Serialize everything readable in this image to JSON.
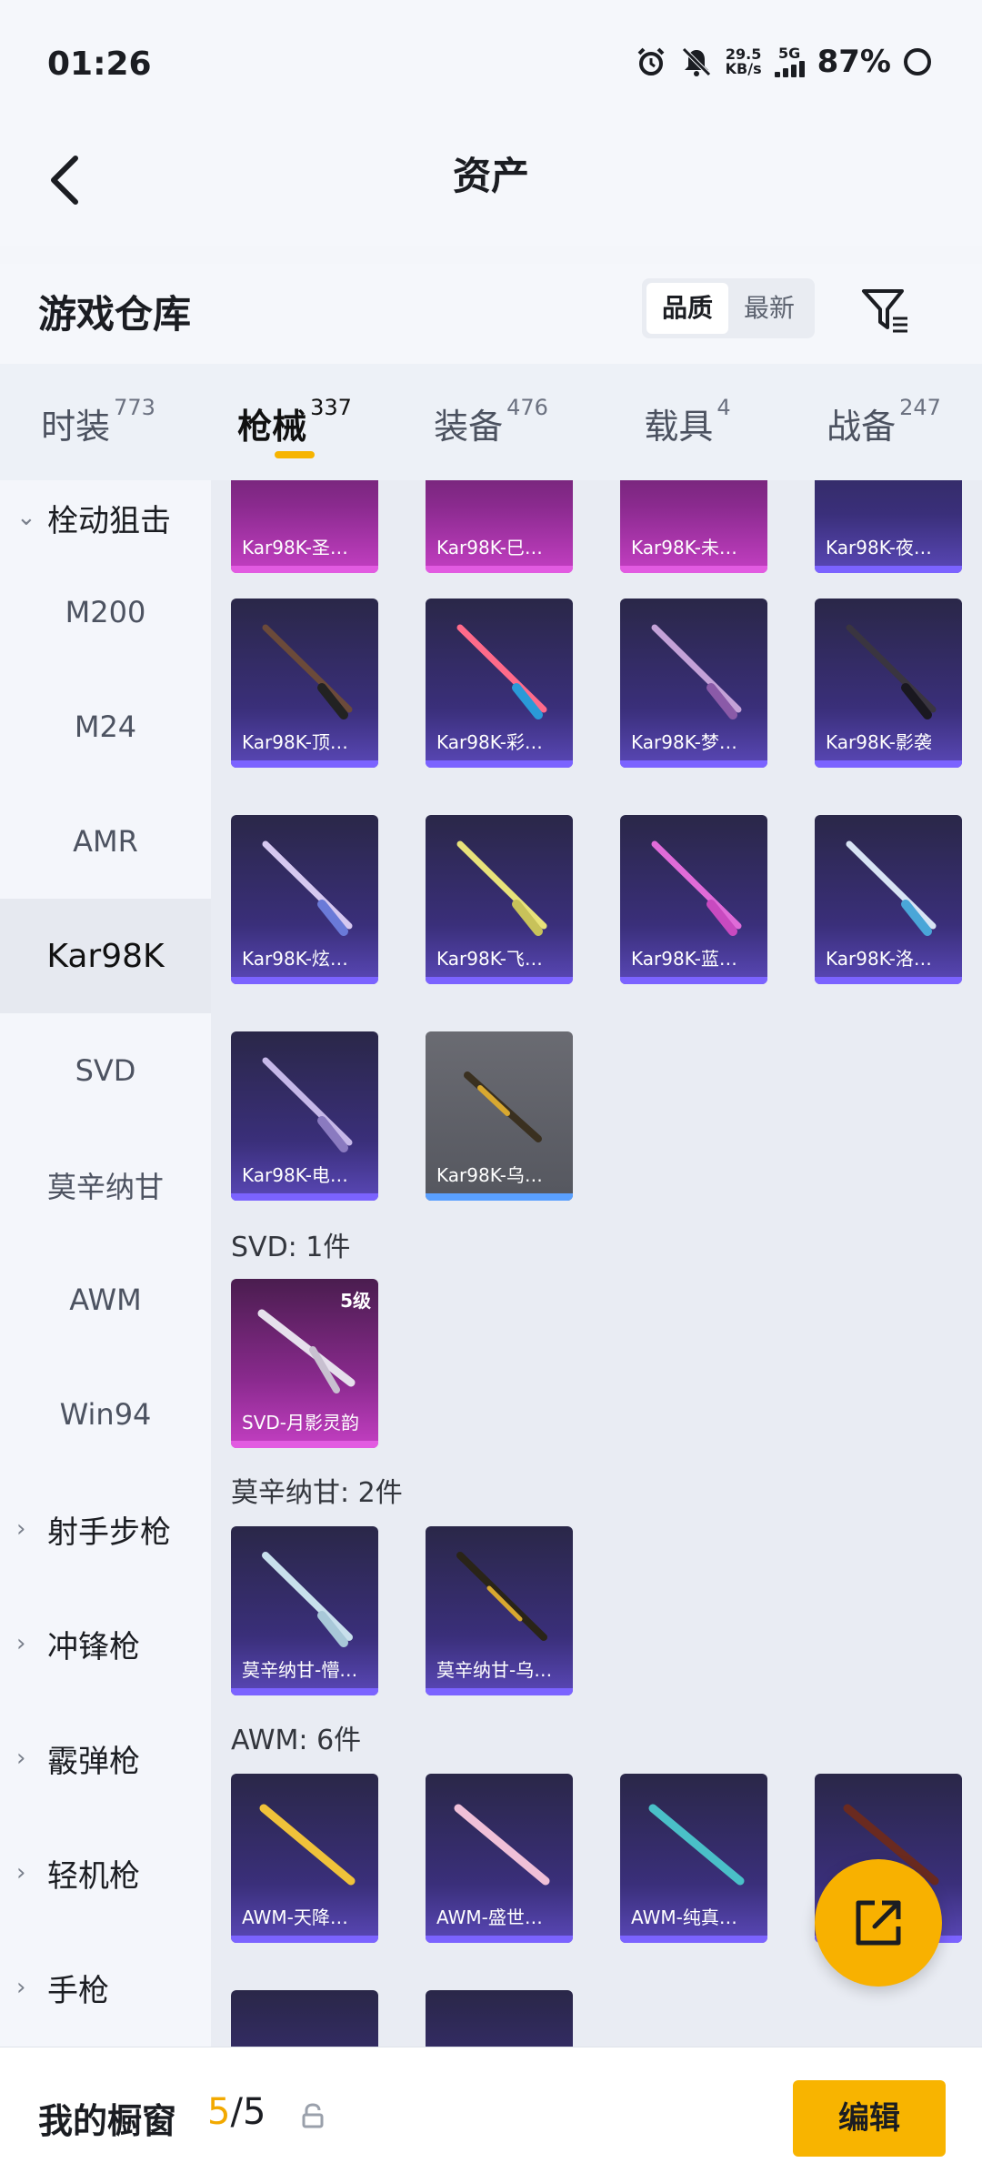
{
  "status_bar": {
    "time": "01:26",
    "net_speed_value": "29.5",
    "net_speed_unit": "KB/s",
    "network": "5G",
    "battery": "87%"
  },
  "header": {
    "title": "资产"
  },
  "warehouse": {
    "title": "游戏仓库",
    "sort_options": [
      "品质",
      "最新"
    ],
    "sort_selected": "品质"
  },
  "tabs": [
    {
      "label": "时装",
      "count": "773"
    },
    {
      "label": "枪械",
      "count": "337",
      "active": true
    },
    {
      "label": "装备",
      "count": "476"
    },
    {
      "label": "载具",
      "count": "4"
    },
    {
      "label": "战备",
      "count": "247"
    }
  ],
  "sidebar": {
    "items": [
      {
        "label": "栓动狙击",
        "type": "group",
        "expanded": true
      },
      {
        "label": "M200"
      },
      {
        "label": "M24"
      },
      {
        "label": "AMR"
      },
      {
        "label": "Kar98K",
        "selected": true
      },
      {
        "label": "SVD"
      },
      {
        "label": "莫辛纳甘"
      },
      {
        "label": "AWM"
      },
      {
        "label": "Win94"
      },
      {
        "label": "射手步枪",
        "type": "group"
      },
      {
        "label": "冲锋枪",
        "type": "group"
      },
      {
        "label": "霰弹枪",
        "type": "group"
      },
      {
        "label": "轻机枪",
        "type": "group"
      },
      {
        "label": "手枪",
        "type": "group"
      }
    ]
  },
  "grid": {
    "kar98k_partial_row": [
      "Kar98K-圣…",
      "Kar98K-巳…",
      "Kar98K-未…",
      "Kar98K-夜…"
    ],
    "kar98k_row2": [
      "Kar98K-顶…",
      "Kar98K-彩…",
      "Kar98K-梦…",
      "Kar98K-影袭"
    ],
    "kar98k_row3": [
      "Kar98K-炫…",
      "Kar98K-飞…",
      "Kar98K-蓝…",
      "Kar98K-洛…"
    ],
    "kar98k_row4": [
      "Kar98K-电…",
      "Kar98K-乌…"
    ],
    "svd_section": "SVD: 1件",
    "svd_items": [
      {
        "name": "SVD-月影灵韵",
        "level": "5级"
      }
    ],
    "mosin_section": "莫辛纳甘: 2件",
    "mosin_items": [
      "莫辛纳甘-懵…",
      "莫辛纳甘-乌…"
    ],
    "awm_section": "AWM: 6件",
    "awm_items": [
      "AWM-天降…",
      "AWM-盛世…",
      "AWM-纯真…"
    ]
  },
  "bottom_bar": {
    "title": "我的橱窗",
    "current": "5",
    "separator": "/",
    "total": "5",
    "edit_label": "编辑"
  },
  "colors": {
    "accent": "#f8b400",
    "rarity_purple": "#7b63ff",
    "rarity_magenta": "#e25be1"
  }
}
